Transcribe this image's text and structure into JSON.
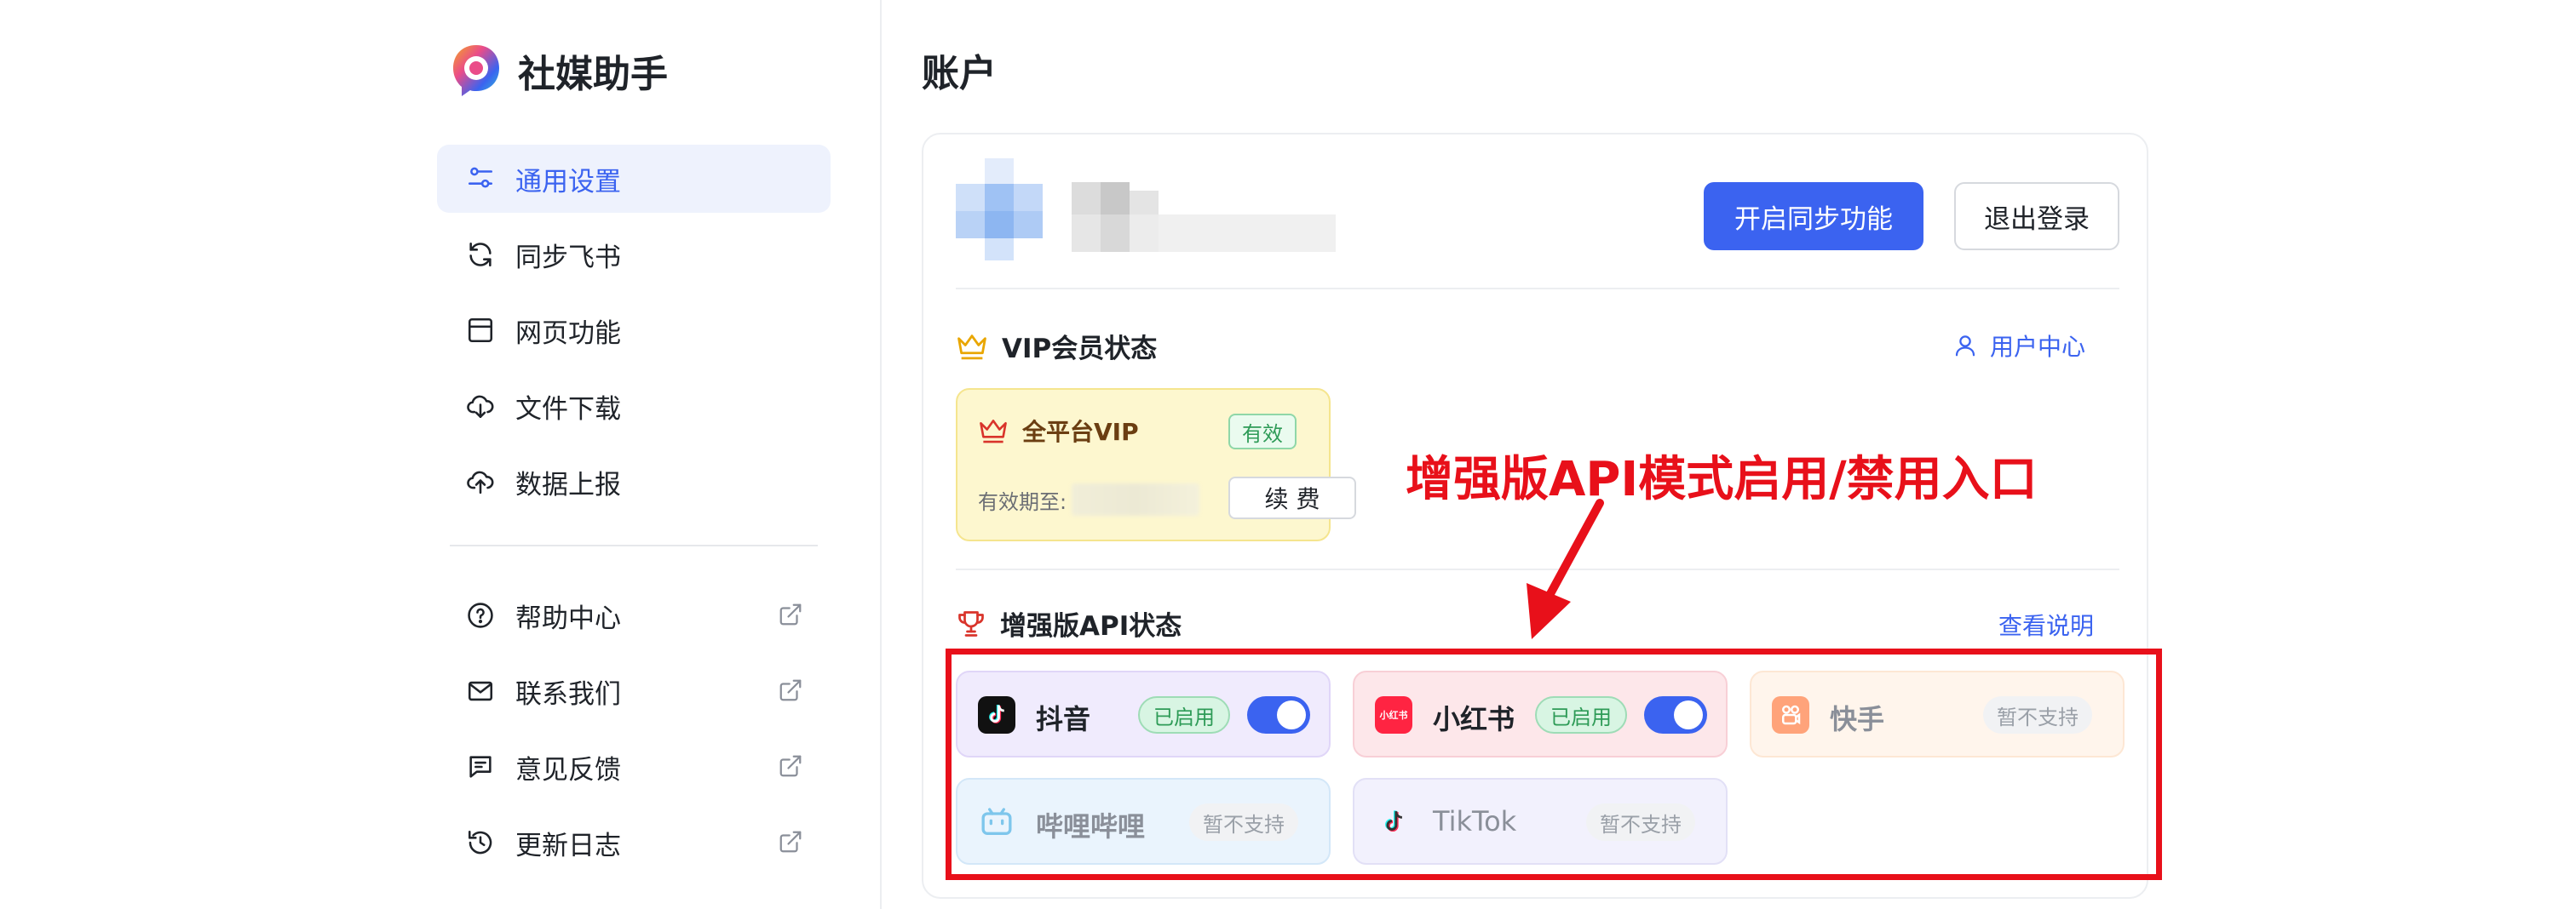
{
  "app": {
    "name": "社媒助手"
  },
  "sidebar": {
    "items": [
      {
        "label": "通用设置",
        "icon": "sliders-icon",
        "active": true
      },
      {
        "label": "同步飞书",
        "icon": "sync-icon"
      },
      {
        "label": "网页功能",
        "icon": "browser-window-icon"
      },
      {
        "label": "文件下载",
        "icon": "cloud-download-icon"
      },
      {
        "label": "数据上报",
        "icon": "cloud-upload-icon"
      }
    ],
    "links": [
      {
        "label": "帮助中心",
        "icon": "help-circle-icon"
      },
      {
        "label": "联系我们",
        "icon": "mail-icon"
      },
      {
        "label": "意见反馈",
        "icon": "feedback-icon"
      },
      {
        "label": "更新日志",
        "icon": "history-icon"
      }
    ]
  },
  "main": {
    "title": "账户",
    "actions": {
      "sync": "开启同步功能",
      "logout": "退出登录"
    },
    "vip": {
      "section_title": "VIP会员状态",
      "user_center": "用户中心",
      "plan": "全平台VIP",
      "status": "有效",
      "expiry_label": "有效期至:",
      "renew": "续 费"
    },
    "api": {
      "section_title": "增强版API状态",
      "help_link": "查看说明",
      "platforms": [
        {
          "name": "抖音",
          "status": "已启用",
          "enabled": true,
          "icon": "douyin-icon"
        },
        {
          "name": "小红书",
          "status": "已启用",
          "enabled": true,
          "icon": "xiaohongshu-icon",
          "logo_text": "小红书"
        },
        {
          "name": "快手",
          "status": "暂不支持",
          "icon": "kuaishou-icon"
        },
        {
          "name": "哔哩哔哩",
          "status": "暂不支持",
          "icon": "bilibili-icon"
        },
        {
          "name": "TikTok",
          "status": "暂不支持",
          "icon": "tiktok-icon"
        }
      ]
    }
  },
  "annotation": {
    "text": "增强版API模式启用/禁用入口"
  },
  "colors": {
    "accent": "#3b63f0",
    "annotation": "#e8101a",
    "success": "#2e9b57"
  }
}
